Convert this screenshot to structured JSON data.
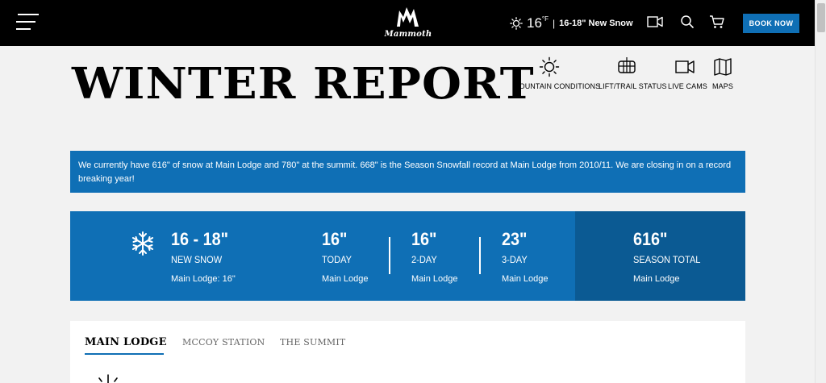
{
  "header": {
    "logo_text": "Mammoth",
    "weather_temp": "16",
    "weather_unit": "°F",
    "weather_separator": "|",
    "weather_snow": "16-18\" New Snow",
    "book_label": "BOOK NOW"
  },
  "page": {
    "title": "WINTER REPORT"
  },
  "quicklinks": [
    {
      "label": "MOUNTAIN CONDITIONS",
      "icon": "sun-icon"
    },
    {
      "label": "LIFT/TRAIL STATUS",
      "icon": "chairlift-icon"
    },
    {
      "label": "LIVE CAMS",
      "icon": "video-camera-icon"
    },
    {
      "label": "MAPS",
      "icon": "map-icon"
    }
  ],
  "alert": {
    "text": "We currently have 616\" of snow at Main Lodge and 780\" at the summit. 668\" is the Season Snowfall record at Main Lodge from 2010/11. We are closing in on a record breaking year!"
  },
  "snow_stats": {
    "new_snow": {
      "value": "16 - 18\"",
      "label": "NEW SNOW",
      "sub": "Main Lodge: 16\""
    },
    "today": {
      "value": "16\"",
      "label": "TODAY",
      "sub": "Main Lodge"
    },
    "two_day": {
      "value": "16\"",
      "label": "2-DAY",
      "sub": "Main Lodge"
    },
    "three_day": {
      "value": "23\"",
      "label": "3-DAY",
      "sub": "Main Lodge"
    },
    "season_total": {
      "value": "616\"",
      "label": "SEASON TOTAL",
      "sub": "Main Lodge"
    }
  },
  "tabs": [
    {
      "label": "MAIN LODGE",
      "active": true
    },
    {
      "label": "MCCOY STATION",
      "active": false
    },
    {
      "label": "THE SUMMIT",
      "active": false
    }
  ],
  "colors": {
    "brand_blue": "#0f6fb5",
    "dark_blue": "#0b5a93",
    "header_black": "#000000"
  }
}
